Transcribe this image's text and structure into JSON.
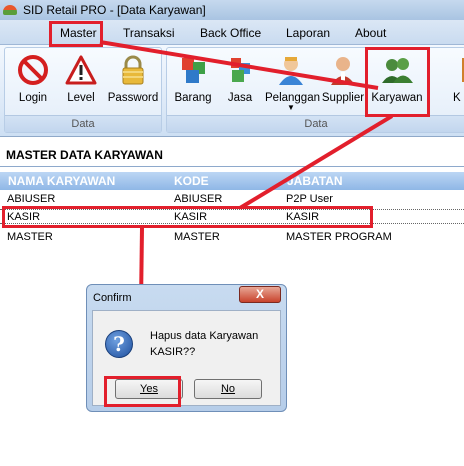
{
  "window": {
    "title": "SID Retail PRO - [Data Karyawan]"
  },
  "menu": [
    "Master",
    "Transaksi",
    "Back Office",
    "Laporan",
    "About"
  ],
  "ribbon": {
    "groups": [
      {
        "label": "Data",
        "buttons": [
          {
            "label": "Login",
            "icon": "no-entry-icon"
          },
          {
            "label": "Level",
            "icon": "warning-icon"
          },
          {
            "label": "Password",
            "icon": "padlock-icon"
          }
        ]
      },
      {
        "label": "Data",
        "buttons": [
          {
            "label": "Barang",
            "icon": "cubes-icon"
          },
          {
            "label": "Jasa",
            "icon": "cube-icon"
          },
          {
            "label": "Pelanggan",
            "icon": "customer-icon"
          },
          {
            "label": "Supplier",
            "icon": "supplier-icon"
          },
          {
            "label": "Karyawan",
            "icon": "employees-icon"
          },
          {
            "label": "K",
            "icon": "next-icon"
          }
        ]
      }
    ]
  },
  "section": {
    "title": "MASTER DATA KARYAWAN"
  },
  "table": {
    "columns": [
      "NAMA KARYAWAN",
      "KODE",
      "JABATAN"
    ],
    "rows": [
      [
        "ABIUSER",
        "ABIUSER",
        "P2P User"
      ],
      [
        "KASIR",
        "KASIR",
        "KASIR"
      ],
      [
        "MASTER",
        "MASTER",
        "MASTER PROGRAM"
      ]
    ]
  },
  "dialog": {
    "title": "Confirm",
    "close": "X",
    "message_line1": "Hapus data Karyawan",
    "message_line2": "KASIR??",
    "yes": "Yes",
    "no": "No"
  },
  "colors": {
    "highlight": "#e21f2c",
    "header_bg": "#8fb7e6"
  }
}
